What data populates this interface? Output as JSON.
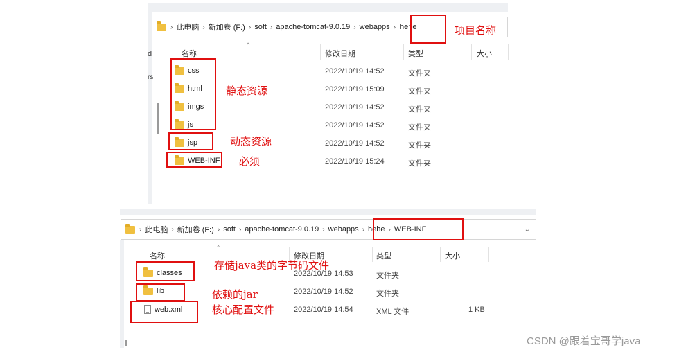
{
  "top": {
    "breadcrumb": [
      "此电脑",
      "新加卷 (F:)",
      "soft",
      "apache-tomcat-9.0.19",
      "webapps",
      "hehe"
    ],
    "columns": {
      "name": "名称",
      "modified": "修改日期",
      "type": "类型",
      "size": "大小"
    },
    "left_nav_fragments": [
      "d",
      "rs"
    ],
    "rows": [
      {
        "name": "css",
        "modified": "2022/10/19 14:52",
        "type": "文件夹",
        "size": ""
      },
      {
        "name": "html",
        "modified": "2022/10/19 15:09",
        "type": "文件夹",
        "size": ""
      },
      {
        "name": "imgs",
        "modified": "2022/10/19 14:52",
        "type": "文件夹",
        "size": ""
      },
      {
        "name": "js",
        "modified": "2022/10/19 14:52",
        "type": "文件夹",
        "size": ""
      },
      {
        "name": "jsp",
        "modified": "2022/10/19 14:52",
        "type": "文件夹",
        "size": ""
      },
      {
        "name": "WEB-INF",
        "modified": "2022/10/19 15:24",
        "type": "文件夹",
        "size": ""
      }
    ],
    "annotations": {
      "project_name": "项目名称",
      "static": "静态资源",
      "dynamic": "动态资源",
      "required": "必须"
    }
  },
  "bottom": {
    "breadcrumb": [
      "此电脑",
      "新加卷 (F:)",
      "soft",
      "apache-tomcat-9.0.19",
      "webapps",
      "hehe",
      "WEB-INF"
    ],
    "columns": {
      "name": "名称",
      "modified": "修改日期",
      "type": "类型",
      "size": "大小"
    },
    "rows": [
      {
        "name": "classes",
        "modified": "2022/10/19 14:53",
        "type": "文件夹",
        "size": "",
        "icon": "folder-icon"
      },
      {
        "name": "lib",
        "modified": "2022/10/19 14:52",
        "type": "文件夹",
        "size": "",
        "icon": "folder-icon"
      },
      {
        "name": "web.xml",
        "modified": "2022/10/19 14:54",
        "type": "XML 文件",
        "size": "1 KB",
        "icon": "file-icon"
      }
    ],
    "annotations": {
      "classes": "存储java类的字节码文件",
      "lib": "依赖的jar",
      "webxml": "核心配置文件"
    }
  },
  "watermark": "CSDN @跟着宝哥学java",
  "colors": {
    "annotation_red": "#e01010",
    "folder_yellow": "#f0c040"
  }
}
